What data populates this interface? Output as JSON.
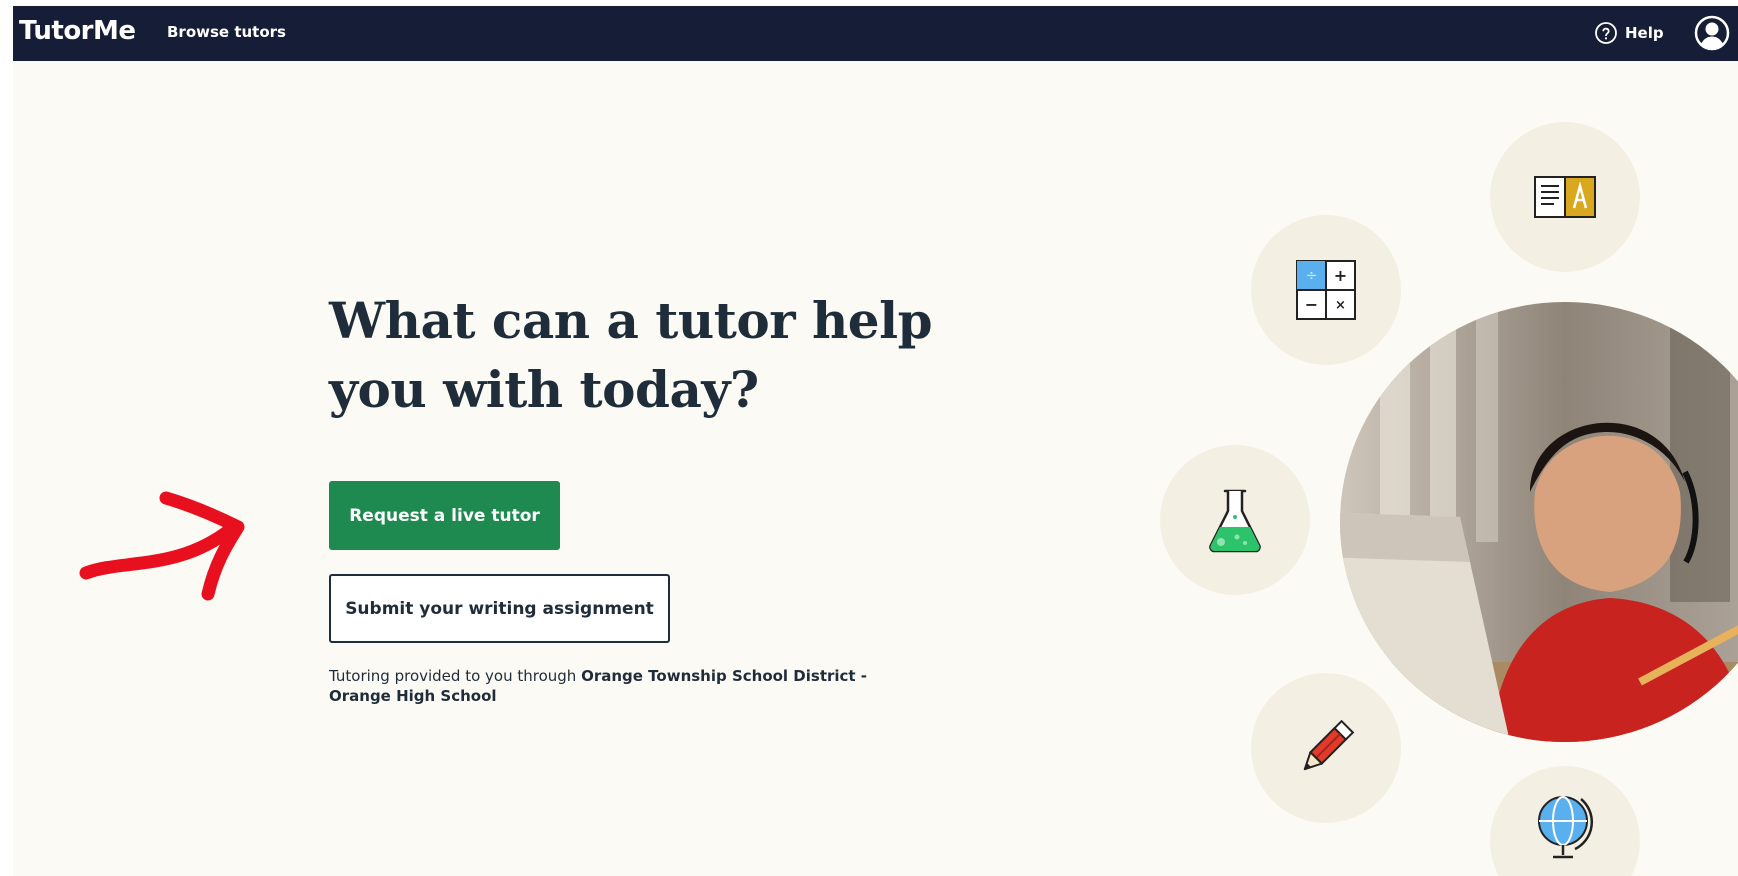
{
  "nav": {
    "logo": "TutorMe",
    "browse_label": "Browse tutors",
    "help_label": "Help"
  },
  "hero": {
    "headline": "What can a tutor help you with today?",
    "primary_button": "Request a live tutor",
    "secondary_button": "Submit your writing assignment",
    "provided_prefix": "Tutoring provided to you through ",
    "provided_org": "Orange Township School District - Orange High School"
  },
  "icons": [
    "books-icon",
    "calculator-icon",
    "flask-icon",
    "pencil-icon",
    "globe-icon",
    "help-circle-icon",
    "user-avatar-icon"
  ],
  "colors": {
    "nav_bg": "#161d36",
    "page_bg": "#fcfaf4",
    "primary_green": "#1e8a4f",
    "text_dark": "#1f2d3a",
    "annotation_red": "#e8101f"
  }
}
